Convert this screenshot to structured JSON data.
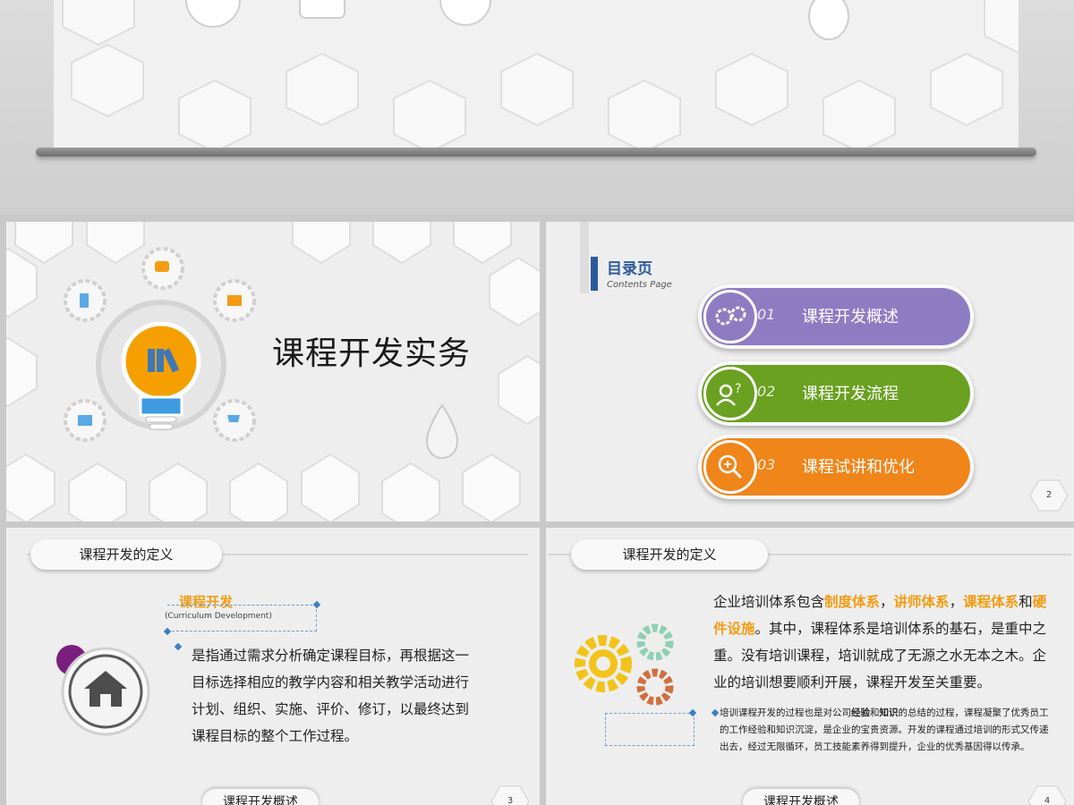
{
  "slide1": {
    "title": "课程开发实务"
  },
  "slide2": {
    "toc_title": "目录页",
    "toc_subtitle": "Contents Page",
    "items": [
      {
        "num": "01",
        "label": "课程开发概述",
        "color": "#8e7cc3"
      },
      {
        "num": "02",
        "label": "课程开发流程",
        "color": "#6aa121"
      },
      {
        "num": "03",
        "label": "课程试讲和优化",
        "color": "#f0851a"
      }
    ],
    "page_number": "2"
  },
  "slide3": {
    "header": "课程开发的定义",
    "keyword": "课程开发",
    "keyword_en": "(Curriculum Development)",
    "body": "是指通过需求分析确定课程目标，再根据这一目标选择相应的教学内容和相关教学活动进行计划、组织、实施、评价、修订，以最终达到课程目标的整个工作过程。",
    "footer": "课程开发概述",
    "page_number": "3"
  },
  "slide4": {
    "header": "课程开发的定义",
    "body_parts": {
      "p1": "企业培训体系包含",
      "h1": "制度体系",
      "sep1": "，",
      "h2": "讲师体系",
      "sep2": "，",
      "h3": "课程体系",
      "p2": "和",
      "h4": "硬件设施",
      "p3": "。其中，课程体系是培训体系的基石，是重中之重。没有培训课程，培训就成了无源之水无本之木。企业的培训想要顺利开展，课程开发至关重要。"
    },
    "small_parts": {
      "s1": "培训课程开发的过程也是对公司",
      "b1": "经验",
      "s2": "和",
      "b2": "知识",
      "s3": "的总结的过程，课程凝聚了优秀员工的工作经验和知识沉淀，是企业的宝贵资源。开发的课程通过培训的形式又传递出去，经过无限循环，员工技能素养得到提升，企业的优秀基因得以传承。"
    },
    "footer": "课程开发概述",
    "page_number": "4"
  }
}
